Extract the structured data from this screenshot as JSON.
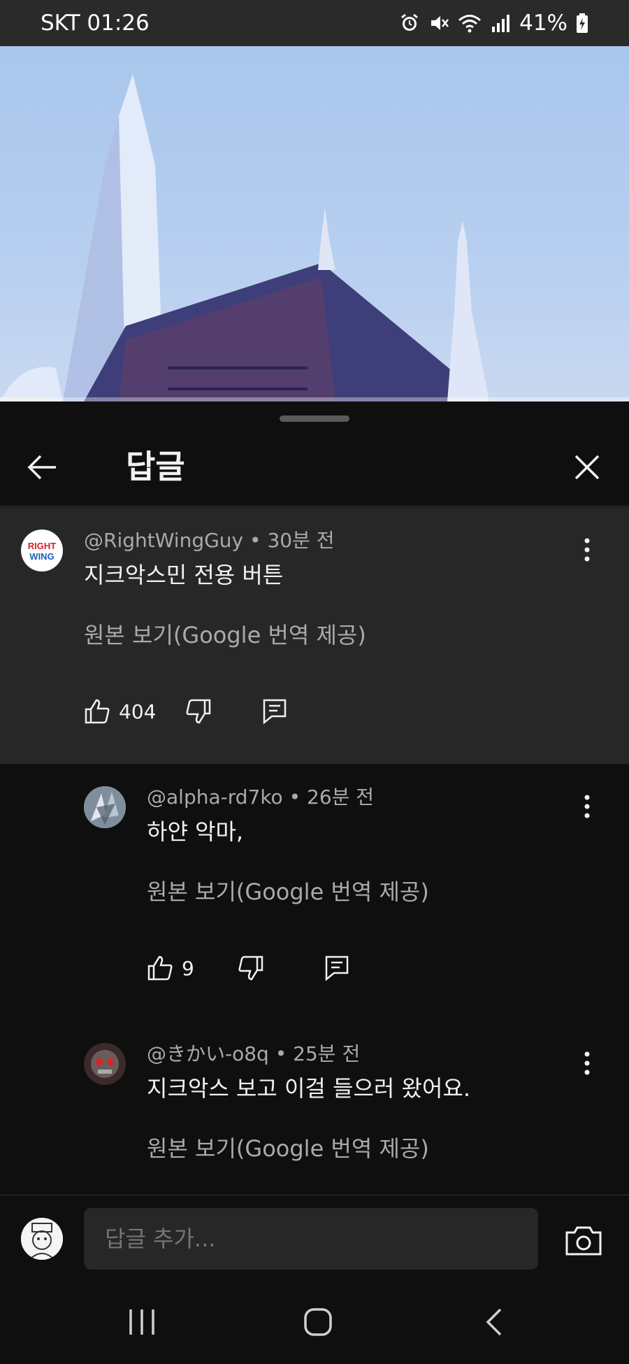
{
  "status_bar": {
    "carrier_time": "SKT 01:26",
    "battery": "41%"
  },
  "video": {
    "progress": 0.075
  },
  "sheet": {
    "title": "답글"
  },
  "comments": [
    {
      "author": "@RightWingGuy",
      "time": "30분 전",
      "text": "지크악스민 전용 버튼",
      "translate": "원본 보기(Google 번역 제공)",
      "likes": "404",
      "avatar_text": [
        "RIGHT",
        "WING"
      ]
    },
    {
      "author": "@alpha-rd7ko",
      "time": "26분 전",
      "text": "하얀 악마,",
      "translate": "원본 보기(Google 번역 제공)",
      "likes": "9"
    },
    {
      "author": "@きかい-o8q",
      "time": "25분 전",
      "text": "지크악스 보고 이걸 들으러 왔어요.",
      "translate": "원본 보기(Google 번역 제공)"
    }
  ],
  "input": {
    "placeholder": "답글 추가..."
  },
  "colors": {
    "background": "#0f0f0f",
    "highlight": "#272727",
    "secondary_text": "#aaaaaa"
  }
}
